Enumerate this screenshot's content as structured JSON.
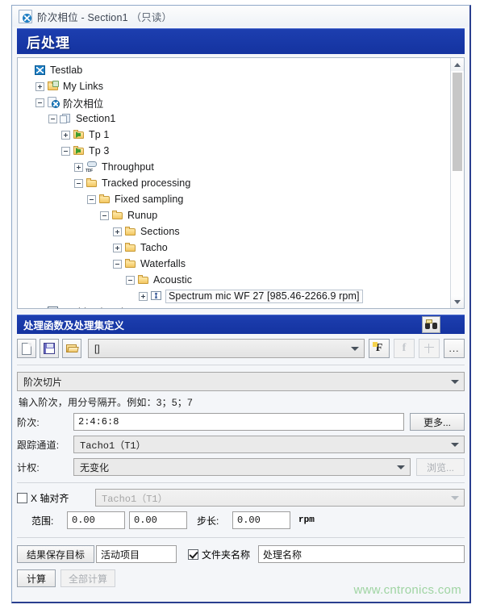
{
  "window": {
    "title_main": "阶次相位 - Section1",
    "title_readonly": "（只读）",
    "icon": "project-doc-icon"
  },
  "header": {
    "title": "后处理"
  },
  "tree": {
    "nodes": [
      {
        "label": "Testlab",
        "depth": 0,
        "toggle": "none",
        "icon": "testlab-logo-icon",
        "selected": false
      },
      {
        "label": "My Links",
        "depth": 1,
        "toggle": "plus",
        "icon": "folder-link-icon",
        "selected": false
      },
      {
        "label": "阶次相位",
        "depth": 1,
        "toggle": "minus",
        "icon": "project-doc-icon",
        "selected": false
      },
      {
        "label": "Section1",
        "depth": 2,
        "toggle": "minus",
        "icon": "section-icon",
        "selected": false
      },
      {
        "label": "Tp 1",
        "depth": 3,
        "toggle": "plus",
        "icon": "folder-arrow-icon",
        "selected": false
      },
      {
        "label": "Tp 3",
        "depth": 3,
        "toggle": "minus",
        "icon": "folder-arrow-icon",
        "selected": false
      },
      {
        "label": "Throughput",
        "depth": 4,
        "toggle": "plus",
        "icon": "tdf-icon",
        "selected": false
      },
      {
        "label": "Tracked processing",
        "depth": 4,
        "toggle": "minus",
        "icon": "folder-icon",
        "selected": false
      },
      {
        "label": "Fixed sampling",
        "depth": 5,
        "toggle": "minus",
        "icon": "folder-icon",
        "selected": false
      },
      {
        "label": "Runup",
        "depth": 6,
        "toggle": "minus",
        "icon": "folder-icon",
        "selected": false
      },
      {
        "label": "Sections",
        "depth": 7,
        "toggle": "plus",
        "icon": "folder-icon",
        "selected": false
      },
      {
        "label": "Tacho",
        "depth": 7,
        "toggle": "plus",
        "icon": "folder-icon",
        "selected": false
      },
      {
        "label": "Waterfalls",
        "depth": 7,
        "toggle": "minus",
        "icon": "folder-icon",
        "selected": false
      },
      {
        "label": "Acoustic",
        "depth": 8,
        "toggle": "minus",
        "icon": "folder-icon",
        "selected": false
      },
      {
        "label": "Spectrum mic WF 27 [985.46-2266.9 rpm]",
        "depth": 9,
        "toggle": "plus",
        "icon": "waterfall-data-icon",
        "selected": true
      },
      {
        "label": "ArchivedSettings",
        "depth": 1,
        "toggle": "none",
        "icon": "archived-settings-icon",
        "selected": false
      }
    ],
    "scrollbar": {
      "up_arrow": "▲",
      "down_arrow": "▼"
    }
  },
  "section": {
    "title": "处理函数及处理集定义",
    "search_icon": "binoculars-icon"
  },
  "toolbar": {
    "new_icon": "new-document-icon",
    "save_icon": "save-icon",
    "open_icon": "open-folder-icon",
    "set_combo_value": "[]",
    "new_function_label": "F",
    "edit_function_label": "f",
    "split_function_label": "",
    "more_label": "...",
    "new_function_enabled": true,
    "edit_function_enabled": false,
    "split_function_enabled": false,
    "more_enabled": true
  },
  "form": {
    "process_type": "阶次切片",
    "hint": "输入阶次，用分号隔开。例如：3；5；7",
    "order_label": "阶次:",
    "order_value": "2:4:6:8",
    "more_button": "更多...",
    "tacho_label": "跟踪通道:",
    "tacho_value": "Tacho1（T1）",
    "weighting_label": "计权:",
    "weighting_value": "无变化",
    "browse_button": "浏览...",
    "x_align_label": "X 轴对齐",
    "x_align_checked": false,
    "x_align_channel": "Tacho1（T1）",
    "range_label": "范围:",
    "range_from": "0.00",
    "range_to": "0.00",
    "step_label": "步长:",
    "step_value": "0.00",
    "unit": "rpm"
  },
  "footer": {
    "save_target_button": "结果保存目标",
    "save_target_value": "活动项目",
    "folder_name_label": "文件夹名称",
    "folder_name_checked": true,
    "folder_name_value": "处理名称",
    "calculate_button": "计算",
    "calculate_all_button": "全部计算",
    "calculate_all_enabled": false
  },
  "watermark": {
    "text": "www.cntronics.com",
    "color": "#9fd4a2"
  }
}
